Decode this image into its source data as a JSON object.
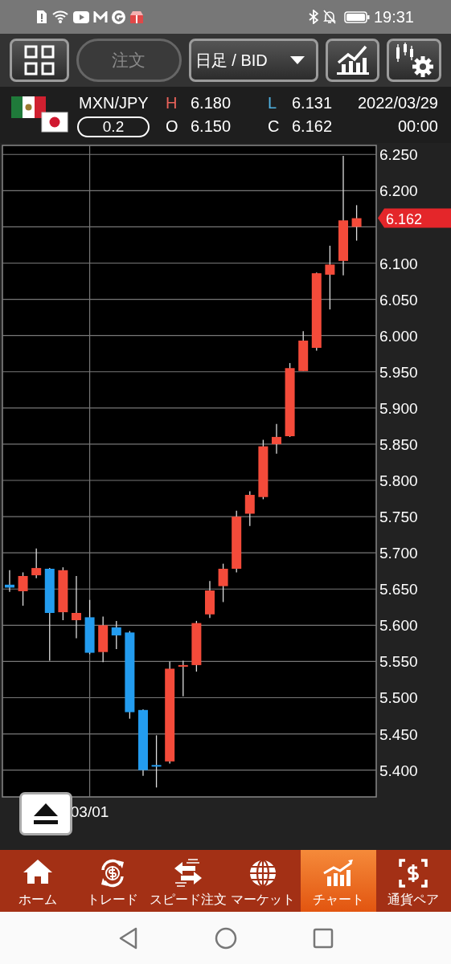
{
  "status_bar": {
    "time": "19:31"
  },
  "toolbar": {
    "order_button": {
      "label": "注文",
      "disabled": true
    },
    "timeframe_dropdown": {
      "value": "日足 / BID"
    }
  },
  "quote": {
    "pair": "MXN/JPY",
    "spread": "0.2",
    "high_label": "H",
    "high": "6.180",
    "low_label": "L",
    "low": "6.131",
    "open_label": "O",
    "open": "6.150",
    "close_label": "C",
    "close": "6.162",
    "date": "2022/03/29",
    "time": "00:00"
  },
  "chart": {
    "price_tag": "6.162",
    "chart_data": {
      "type": "candlestick",
      "ylim": [
        5.363,
        6.2625
      ],
      "grid": true,
      "yticks": [
        {
          "value": 5.4,
          "label": "5.400"
        },
        {
          "value": 5.45,
          "label": "5.450"
        },
        {
          "value": 5.5,
          "label": "5.500"
        },
        {
          "value": 5.55,
          "label": "5.550"
        },
        {
          "value": 5.6,
          "label": "5.600"
        },
        {
          "value": 5.65,
          "label": "5.650"
        },
        {
          "value": 5.7,
          "label": "5.700"
        },
        {
          "value": 5.75,
          "label": "5.750"
        },
        {
          "value": 5.8,
          "label": "5.800"
        },
        {
          "value": 5.85,
          "label": "5.850"
        },
        {
          "value": 5.9,
          "label": "5.900"
        },
        {
          "value": 5.95,
          "label": "5.950"
        },
        {
          "value": 6.0,
          "label": "6.000"
        },
        {
          "value": 6.05,
          "label": "6.050"
        },
        {
          "value": 6.1,
          "label": "6.100"
        },
        {
          "value": 6.2,
          "label": "6.200"
        },
        {
          "value": 6.25,
          "label": "6.250"
        }
      ],
      "annotations": [
        "03/01"
      ],
      "ohlc": [
        [
          5.656,
          5.676,
          5.646,
          5.652
        ],
        [
          5.647,
          5.673,
          5.627,
          5.668
        ],
        [
          5.669,
          5.706,
          5.665,
          5.679
        ],
        [
          5.678,
          5.679,
          5.551,
          5.617
        ],
        [
          5.618,
          5.68,
          5.607,
          5.676
        ],
        [
          5.607,
          5.668,
          5.582,
          5.617
        ],
        [
          5.611,
          5.635,
          5.56,
          5.562
        ],
        [
          5.563,
          5.612,
          5.549,
          5.6
        ],
        [
          5.597,
          5.606,
          5.567,
          5.586
        ],
        [
          5.59,
          5.592,
          5.471,
          5.48
        ],
        [
          5.483,
          5.484,
          5.392,
          5.4
        ],
        [
          5.407,
          5.448,
          5.376,
          5.406
        ],
        [
          5.412,
          5.55,
          5.409,
          5.54
        ],
        [
          5.543,
          5.551,
          5.502,
          5.545
        ],
        [
          5.545,
          5.606,
          5.536,
          5.603
        ],
        [
          5.615,
          5.661,
          5.61,
          5.648
        ],
        [
          5.654,
          5.685,
          5.632,
          5.678
        ],
        [
          5.678,
          5.758,
          5.673,
          5.75
        ],
        [
          5.754,
          5.785,
          5.737,
          5.78
        ],
        [
          5.777,
          5.856,
          5.774,
          5.847
        ],
        [
          5.85,
          5.878,
          5.837,
          5.86
        ],
        [
          5.861,
          5.962,
          5.86,
          5.955
        ],
        [
          5.951,
          6.006,
          5.951,
          5.993
        ],
        [
          5.983,
          6.087,
          5.979,
          6.086
        ],
        [
          6.084,
          6.124,
          6.036,
          6.098
        ],
        [
          6.103,
          6.248,
          6.083,
          6.159
        ],
        [
          6.15,
          6.18,
          6.131,
          6.162
        ]
      ]
    }
  },
  "tabs": [
    {
      "label": "ホーム",
      "kind": "home",
      "selected": false
    },
    {
      "label": "トレード",
      "kind": "trade",
      "selected": false
    },
    {
      "label": "スピード注文",
      "kind": "speed",
      "selected": false
    },
    {
      "label": "マーケット",
      "kind": "market",
      "selected": false
    },
    {
      "label": "チャート",
      "kind": "chart",
      "selected": true
    },
    {
      "label": "通貨ペア",
      "kind": "pair",
      "selected": false
    }
  ]
}
